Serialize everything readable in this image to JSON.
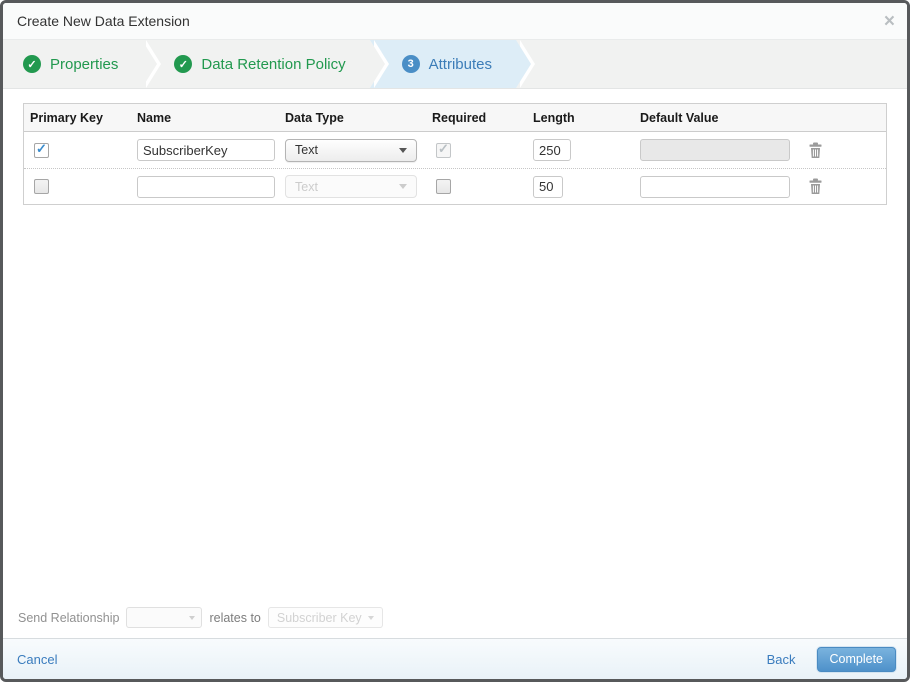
{
  "modal": {
    "title": "Create New Data Extension",
    "close_glyph": "×"
  },
  "wizard": {
    "steps": [
      {
        "label": "Properties",
        "state": "complete",
        "badge": "✓"
      },
      {
        "label": "Data Retention Policy",
        "state": "complete",
        "badge": "✓"
      },
      {
        "label": "Attributes",
        "state": "active",
        "badge": "3"
      }
    ]
  },
  "attributes_table": {
    "headers": [
      "Primary Key",
      "Name",
      "Data Type",
      "Required",
      "Length",
      "Default Value"
    ],
    "rows": [
      {
        "primary_key_checked": true,
        "name": "SubscriberKey",
        "data_type": "Text",
        "data_type_disabled": false,
        "required_checked": true,
        "required_disabled": true,
        "length": "250",
        "default_value": "",
        "default_value_disabled": true
      },
      {
        "primary_key_checked": false,
        "name": "",
        "data_type": "Text",
        "data_type_disabled": true,
        "required_checked": false,
        "required_disabled": false,
        "length": "50",
        "default_value": "",
        "default_value_disabled": false
      }
    ]
  },
  "send_relationship": {
    "label": "Send Relationship",
    "relates_to": "relates to",
    "field": "Subscriber Key"
  },
  "footer": {
    "cancel": "Cancel",
    "back": "Back",
    "complete": "Complete"
  },
  "colors": {
    "accent_green": "#22994f",
    "accent_blue": "#4a8ec6",
    "active_step_bg": "#ddedf7",
    "link": "#3a7cbe",
    "complete_button_top": "#7ab3de",
    "complete_button_bottom": "#4e91ca"
  }
}
